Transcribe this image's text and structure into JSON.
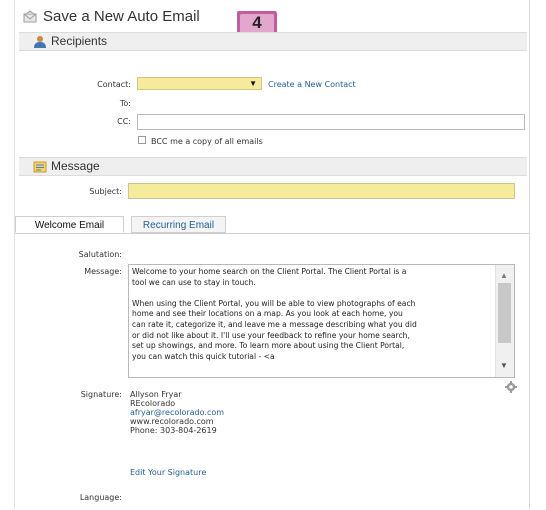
{
  "title": "Save a New Auto Email",
  "step_badge": "4",
  "recipients": {
    "section_title": "Recipients",
    "contact_label": "Contact:",
    "create_contact_link": "Create a New Contact",
    "to_label": "To:",
    "cc_label": "CC:",
    "cc_value": "",
    "bcc_label": "BCC me a copy of all emails"
  },
  "message": {
    "section_title": "Message",
    "subject_label": "Subject:",
    "subject_value": ""
  },
  "tabs": [
    {
      "label": "Welcome Email"
    },
    {
      "label": "Recurring Email"
    }
  ],
  "email": {
    "salutation_label": "Salutation:",
    "message_label": "Message:",
    "message_text": "Welcome to your home search on the Client Portal. The Client Portal is a\ntool we can use to stay in touch.\n\nWhen using the Client Portal, you will be able to view photographs of each\nhome and see their locations on a map. As you look at each home, you\ncan rate it, categorize it, and leave me a message describing what you did\nor did not like about it. I'll use your feedback to refine your home search,\nset up showings, and more. To learn more about using the Client Portal,\nyou can watch this quick tutorial - <a",
    "signature_label": "Signature:",
    "signature_name": "Allyson Fryar",
    "signature_company": "REcolorado",
    "signature_email": "afryar@recolorado.com",
    "signature_website": "www.recolorado.com",
    "signature_phone": "Phone: 303-804-2619",
    "edit_signature_link": "Edit Your Signature",
    "language_label": "Language:"
  },
  "colors": {
    "required_field": "#f5eb9a",
    "badge": "#c35c9e",
    "link": "#1f5f9a"
  }
}
